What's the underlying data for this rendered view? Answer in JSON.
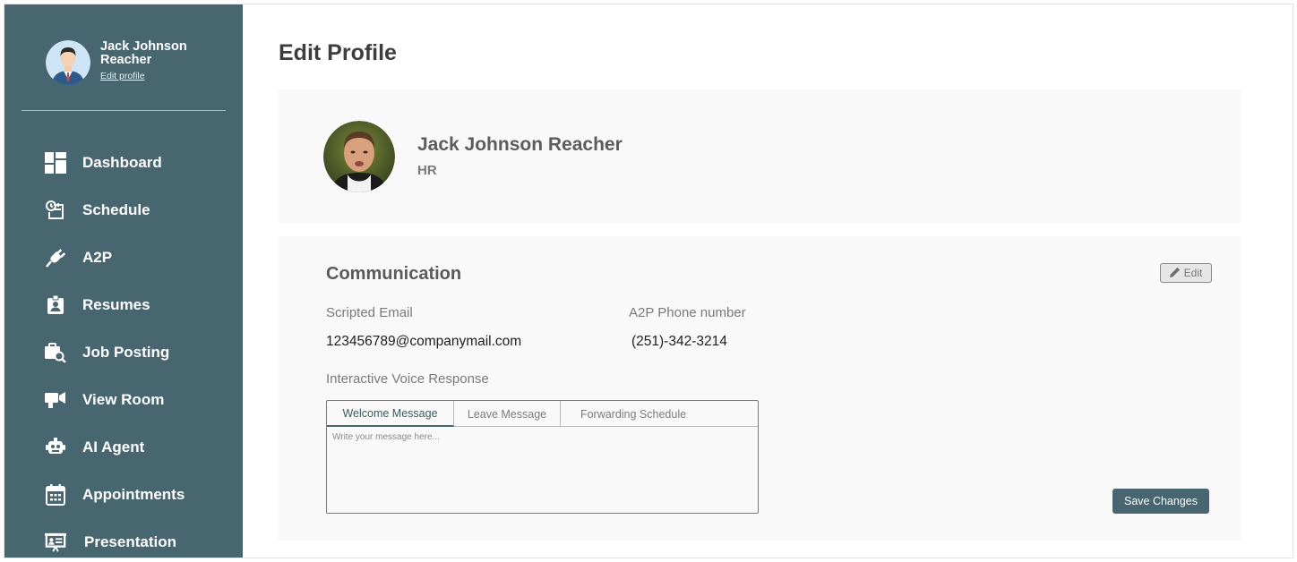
{
  "sidebar": {
    "user_name": "Jack Johnson Reacher",
    "edit_profile_label": "Edit profile",
    "items": [
      {
        "label": "Dashboard",
        "icon": "dashboard-icon"
      },
      {
        "label": "Schedule",
        "icon": "schedule-icon"
      },
      {
        "label": "A2P",
        "icon": "plug-icon"
      },
      {
        "label": "Resumes",
        "icon": "resume-icon"
      },
      {
        "label": "Job Posting",
        "icon": "job-search-icon"
      },
      {
        "label": "View Room",
        "icon": "video-room-icon"
      },
      {
        "label": "AI Agent",
        "icon": "robot-icon"
      },
      {
        "label": "Appointments",
        "icon": "calendar-icon"
      },
      {
        "label": "Presentation",
        "icon": "presentation-icon"
      }
    ]
  },
  "main": {
    "page_title": "Edit Profile",
    "profile": {
      "name": "Jack Johnson Reacher",
      "role": "HR"
    },
    "communication": {
      "title": "Communication",
      "edit_label": "Edit",
      "scripted_email_label": "Scripted Email",
      "scripted_email_value": "123456789@companymail.com",
      "phone_label": "A2P Phone number",
      "phone_value": "(251)-342-3214",
      "ivr_label": "Interactive Voice Response",
      "tabs": [
        "Welcome Message",
        "Leave Message",
        "Forwarding Schedule"
      ],
      "active_tab": "Welcome Message",
      "message_placeholder": "Write your message here...",
      "save_label": "Save Changes"
    }
  },
  "colors": {
    "sidebar_bg": "#476670",
    "card_bg": "#f9f9f9",
    "primary_button": "#476670"
  }
}
